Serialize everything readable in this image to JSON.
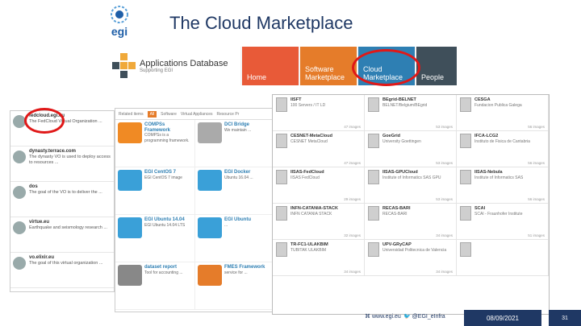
{
  "slide": {
    "title": "The Cloud Marketplace",
    "logo_text": "egi"
  },
  "topbar": {
    "app_title": "Applications Database",
    "app_sub": "Supporting EGI",
    "tiles": [
      {
        "label": "Home",
        "color": "#e85a38"
      },
      {
        "label": "Software Marketplace",
        "color": "#e57c2a"
      },
      {
        "label": "Cloud Marketplace",
        "color": "#2e7fb3"
      },
      {
        "label": "People",
        "color": "#3f4f5a"
      }
    ]
  },
  "left_panel": {
    "items": [
      {
        "name": "fedcloud.egi.eu",
        "desc": "The FedCloud Virtual Organization ..."
      },
      {
        "name": "dynasty.terrace.com",
        "desc": "The dynasty VO is used to deploy access to resources ..."
      },
      {
        "name": "dos",
        "desc": "The goal of the VO is to deliver the ..."
      },
      {
        "name": "virtue.eu",
        "desc": "Earthquake and seismology research ..."
      },
      {
        "name": "vo.elixir.eu",
        "desc": "The goal of this virtual organization ..."
      }
    ]
  },
  "mid_panel": {
    "tabs": [
      "Related items",
      "All",
      "Software",
      "Virtual Appliances",
      "Resource Pr"
    ],
    "cards": [
      {
        "name": "COMPSs Framework",
        "desc": "COMPSs is a programming framework."
      },
      {
        "name": "DCI Bridge",
        "desc": "We maintain ..."
      },
      {
        "name": "EGI CentOS 7",
        "desc": "EGI CentOS 7 image"
      },
      {
        "name": "EGI Docker",
        "desc": "Ubuntu 16.04 ..."
      },
      {
        "name": "EGI Ubuntu 14.04",
        "desc": "EGI Ubuntu 14.04 LTS"
      },
      {
        "name": "EGI Ubuntu",
        "desc": "..."
      },
      {
        "name": "dataset report",
        "desc": "Tool for accounting ..."
      },
      {
        "name": "FMES Framework",
        "desc": "service for ..."
      }
    ]
  },
  "right_panel": {
    "cards": [
      {
        "name": "IISFT",
        "desc": "100 Servers / IT LD",
        "count": "47 images"
      },
      {
        "name": "BEgrid-BELNET",
        "desc": "BELNET/Belgium/BEgrid",
        "count": "53 images"
      },
      {
        "name": "CESGA",
        "desc": "Fundacion Publica Galega",
        "count": "56 images"
      },
      {
        "name": "CESNET-MetaCloud",
        "desc": "CESNET MetaCloud",
        "count": "47 images"
      },
      {
        "name": "GoeGrid",
        "desc": "University Goettingen",
        "count": "53 images"
      },
      {
        "name": "IFCA-LCG2",
        "desc": "Instituto de Fisica de Cantabria",
        "count": "56 images"
      },
      {
        "name": "IISAS-FedCloud",
        "desc": "IISAS FedCloud",
        "count": "29 images"
      },
      {
        "name": "IISAS-GPUCloud",
        "desc": "Institute of Informatics SAS GPU",
        "count": "53 images"
      },
      {
        "name": "IISAS-Nebula",
        "desc": "Institute of Informatics SAS",
        "count": "56 images"
      },
      {
        "name": "INFN-CATANIA-STACK",
        "desc": "INFN CATANIA STACK",
        "count": "32 images"
      },
      {
        "name": "RECAS-BARI",
        "desc": "RECAS-BARI",
        "count": "34 images"
      },
      {
        "name": "SCAI",
        "desc": "SCAI - Fraunhofer Institute",
        "count": "51 images"
      },
      {
        "name": "TR-FC1-ULAKBIM",
        "desc": "TUBITAK ULAKBIM",
        "count": "34 images"
      },
      {
        "name": "UPV-GRyCAP",
        "desc": "Universidad Politecnica de Valencia",
        "count": "34 images"
      },
      {
        "name": "",
        "desc": "",
        "count": ""
      }
    ]
  },
  "footer": {
    "website": "www.egi.eu",
    "twitter": "@EGI_eInfra",
    "date": "08/09/2021",
    "page": "31"
  }
}
